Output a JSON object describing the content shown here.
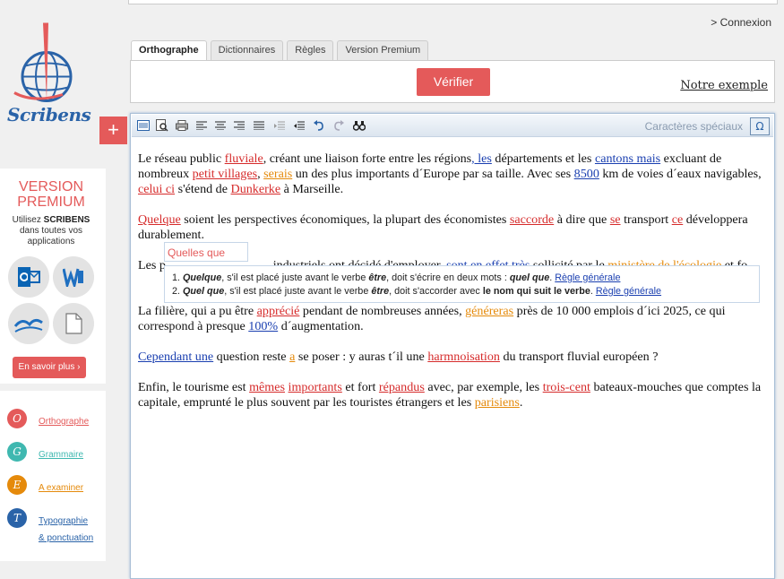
{
  "logo": {
    "text": "Scribens"
  },
  "header": {
    "connexion": "> Connexion"
  },
  "tabs": [
    {
      "label": "Orthographe",
      "active": true
    },
    {
      "label": "Dictionnaires",
      "active": false
    },
    {
      "label": "Règles",
      "active": false
    },
    {
      "label": "Version Premium",
      "active": false
    }
  ],
  "controls": {
    "verify": "Vérifier",
    "example": "Notre exemple"
  },
  "add_button": "+",
  "premium": {
    "title_1": "VERSION",
    "title_2": "PREMIUM",
    "sub_1": "Utilisez",
    "sub_brand": "SCRIBENS",
    "sub_2": "dans toutes vos",
    "sub_3": "applications",
    "cta": "En savoir plus  ›"
  },
  "legend": [
    {
      "letter": "O",
      "label": "Orthographe",
      "color": "#e45a5a"
    },
    {
      "letter": "G",
      "label": "Grammaire",
      "color": "#3fb8b0"
    },
    {
      "letter": "E",
      "label": "A examiner",
      "color": "#e58a0b"
    },
    {
      "letter": "T",
      "label_1": "Typographie",
      "label_2": "& ponctuation",
      "color": "#2a63a8"
    }
  ],
  "toolbar": {
    "special": "Caractères spéciaux",
    "omega": "Ω"
  },
  "suggestion": "Quelles que",
  "rules": {
    "r1_num": "1.",
    "r1_word": "Quelque",
    "r1_text": ", s'il est placé juste avant le verbe ",
    "r1_verb": "être",
    "r1_text2": ", doit s'écrire en deux mots : ",
    "r1_fix": "quel que",
    "r1_end": ".",
    "r1_link": "Règle générale",
    "r2_num": "2.",
    "r2_word": "Quel que",
    "r2_text": ", s'il est placé juste avant le verbe ",
    "r2_verb": "être",
    "r2_text2": ", doit s'accorder avec ",
    "r2_fix": "le nom qui suit le verbe",
    "r2_end": ".",
    "r2_link": "Règle générale"
  },
  "text": {
    "p1": [
      {
        "t": "Le réseau public "
      },
      {
        "t": "fluviale",
        "c": "sp"
      },
      {
        "t": ", créant une liaison forte entre les régions"
      },
      {
        "t": ", les",
        "c": "gr"
      },
      {
        "t": " départements et les "
      },
      {
        "t": "cantons mais",
        "c": "gr"
      },
      {
        "t": " excluant de nombreux "
      },
      {
        "t": "petit villages",
        "c": "sp"
      },
      {
        "t": ", "
      },
      {
        "t": "serais",
        "c": "ex"
      },
      {
        "t": " un des plus importants d´Europe par sa taille. Avec ses "
      },
      {
        "t": "8500",
        "c": "gr"
      },
      {
        "t": " km de voies d´eaux navigables, "
      },
      {
        "t": "celui ci",
        "c": "sp"
      },
      {
        "t": " s'étend de "
      },
      {
        "t": "Dunkerke",
        "c": "sp"
      },
      {
        "t": " à Marseille."
      }
    ],
    "p2": [
      {
        "t": "Quelque",
        "c": "sp"
      },
      {
        "t": " soient les perspectives économiques, la plupart des économistes "
      },
      {
        "t": "saccorde",
        "c": "sp"
      },
      {
        "t": " à dire que "
      },
      {
        "t": "se",
        "c": "sp"
      },
      {
        "t": " transport "
      },
      {
        "t": "ce",
        "c": "sp"
      },
      {
        "t": " développera durablement."
      }
    ],
    "p3": [
      {
        "t": "Les p"
      },
      {
        "t": "                                  industriels ont décidé d'employer, "
      },
      {
        "t": "sont en effet très",
        "c": "gr"
      },
      {
        "t": " sollicité par le "
      },
      {
        "t": "ministère de l'écologie",
        "c": "ex"
      },
      {
        "t": " et fo"
      }
    ],
    "p4": [
      {
        "t": "La filière, qui a pu être "
      },
      {
        "t": "apprécié",
        "c": "sp"
      },
      {
        "t": " pendant de nombreuses années, "
      },
      {
        "t": "généreras",
        "c": "ex"
      },
      {
        "t": " près de 10 000 emplois d´ici 2025, ce qui correspond à presque "
      },
      {
        "t": "100%",
        "c": "gr"
      },
      {
        "t": " d´augmentation."
      }
    ],
    "p5": [
      {
        "t": "Cependant une",
        "c": "gr"
      },
      {
        "t": " question reste "
      },
      {
        "t": "a",
        "c": "ex"
      },
      {
        "t": " se poser : y auras t´il une "
      },
      {
        "t": "harmnoisation",
        "c": "sp"
      },
      {
        "t": " du transport fluvial européen ?"
      }
    ],
    "p6": [
      {
        "t": "Enfin, le tourisme est "
      },
      {
        "t": "mêmes",
        "c": "sp"
      },
      {
        "t": " "
      },
      {
        "t": "importants",
        "c": "sp"
      },
      {
        "t": " et fort "
      },
      {
        "t": "répandus",
        "c": "sp"
      },
      {
        "t": " avec, par exemple, les "
      },
      {
        "t": "trois-cent",
        "c": "sp"
      },
      {
        "t": " bateaux-mouches que comptes la capitale, emprunté le plus souvent par les touristes étrangers et les "
      },
      {
        "t": "parisiens",
        "c": "ex"
      },
      {
        "t": "."
      }
    ]
  }
}
